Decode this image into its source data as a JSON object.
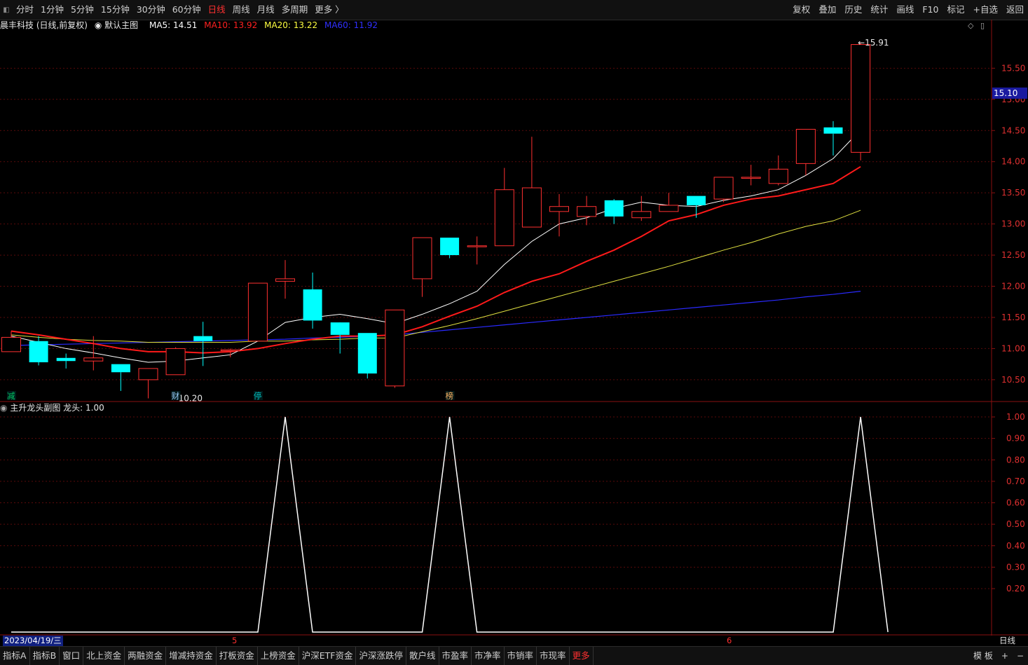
{
  "toolbar": {
    "periods": [
      "分时",
      "1分钟",
      "5分钟",
      "15分钟",
      "30分钟",
      "60分钟",
      "日线",
      "周线",
      "月线",
      "多周期",
      "更多 〉"
    ],
    "active_period": "日线",
    "right_buttons": [
      "复权",
      "叠加",
      "历史",
      "统计",
      "画线",
      "F10",
      "标记",
      "+自选",
      "返回"
    ]
  },
  "info": {
    "stock": "晨丰科技 (日线,前复权)",
    "template": "默认主图",
    "ma5": "MA5: 14.51",
    "ma10": "MA10: 13.92",
    "ma20": "MA20: 13.22",
    "ma60": "MA60: 11.92",
    "colors": {
      "ma5": "#ffffff",
      "ma10": "#ff2020",
      "ma20": "#ffff40",
      "ma60": "#2222ff"
    }
  },
  "sub_panel": {
    "title": "主升龙头副图",
    "value": "龙头: 1.00"
  },
  "markers": [
    {
      "idx": 0,
      "text": "减",
      "color": "#00c060"
    },
    {
      "idx": 6,
      "text": "财",
      "color": "#a0d0ff"
    },
    {
      "idx": 9,
      "text": "停",
      "color": "#00c0c0"
    },
    {
      "idx": 16,
      "text": "榜",
      "color": "#ffb060"
    }
  ],
  "annotations": {
    "low": "10.20",
    "high": "15.91"
  },
  "last_price": "15.10",
  "date_axis": {
    "start": "2023/04/19/三",
    "month_5": "5",
    "month_6": "6",
    "period": "日线"
  },
  "chart_data": {
    "type": "candlestick",
    "price_ticks": [
      "15.50",
      "15.00",
      "14.50",
      "14.00",
      "13.50",
      "13.00",
      "12.50",
      "12.00",
      "11.50",
      "11.00",
      "10.50"
    ],
    "price_range": [
      10.15,
      16.1
    ],
    "ohlc": [
      [
        10.95,
        11.18,
        11.28,
        10.95
      ],
      [
        11.12,
        10.78,
        11.2,
        10.73
      ],
      [
        10.85,
        10.8,
        10.92,
        10.68
      ],
      [
        10.8,
        10.85,
        11.2,
        10.65
      ],
      [
        10.75,
        10.62,
        10.75,
        10.32
      ],
      [
        10.5,
        10.68,
        10.68,
        10.2
      ],
      [
        10.58,
        11.0,
        11.02,
        10.58
      ],
      [
        11.2,
        11.12,
        11.43,
        10.72
      ],
      [
        10.98,
        10.98,
        11.0,
        10.86
      ],
      [
        11.12,
        12.05,
        12.05,
        11.12
      ],
      [
        12.08,
        12.12,
        12.42,
        11.8
      ],
      [
        11.95,
        11.45,
        12.22,
        11.32
      ],
      [
        11.42,
        11.22,
        11.4,
        10.92
      ],
      [
        11.25,
        10.6,
        11.25,
        10.52
      ],
      [
        10.4,
        11.62,
        11.62,
        10.37
      ],
      [
        12.12,
        12.78,
        12.78,
        11.83
      ],
      [
        12.78,
        12.5,
        12.78,
        12.45
      ],
      [
        12.65,
        12.65,
        12.8,
        12.35
      ],
      [
        12.65,
        13.55,
        13.9,
        12.65
      ],
      [
        12.95,
        13.58,
        14.4,
        12.95
      ],
      [
        13.2,
        13.28,
        13.48,
        12.8
      ],
      [
        13.12,
        13.28,
        13.45,
        12.98
      ],
      [
        13.38,
        13.12,
        13.4,
        13.0
      ],
      [
        13.1,
        13.2,
        13.45,
        13.05
      ],
      [
        13.2,
        13.3,
        13.5,
        13.2
      ],
      [
        13.45,
        13.3,
        13.45,
        13.1
      ],
      [
        13.4,
        13.75,
        13.75,
        13.35
      ],
      [
        13.75,
        13.75,
        13.95,
        13.62
      ],
      [
        13.65,
        13.88,
        14.1,
        13.62
      ],
      [
        13.97,
        14.52,
        14.52,
        13.78
      ],
      [
        14.55,
        14.45,
        14.65,
        14.1
      ],
      [
        14.15,
        15.88,
        15.91,
        14.02
      ]
    ],
    "ma5": [
      11.2,
      11.1,
      11.0,
      10.93,
      10.85,
      10.78,
      10.8,
      10.85,
      10.9,
      11.12,
      11.42,
      11.5,
      11.55,
      11.48,
      11.4,
      11.55,
      11.72,
      11.92,
      12.35,
      12.72,
      13.0,
      13.1,
      13.25,
      13.35,
      13.3,
      13.28,
      13.38,
      13.45,
      13.55,
      13.78,
      14.05,
      14.51
    ],
    "ma10": [
      11.28,
      11.22,
      11.15,
      11.08,
      11.0,
      10.95,
      10.95,
      10.93,
      10.95,
      11.0,
      11.08,
      11.15,
      11.2,
      11.2,
      11.22,
      11.35,
      11.52,
      11.68,
      11.9,
      12.08,
      12.2,
      12.4,
      12.58,
      12.8,
      13.05,
      13.15,
      13.3,
      13.4,
      13.45,
      13.55,
      13.65,
      13.92
    ],
    "ma20": [
      11.22,
      11.18,
      11.15,
      11.13,
      11.12,
      11.1,
      11.1,
      11.1,
      11.1,
      11.12,
      11.12,
      11.14,
      11.15,
      11.17,
      11.17,
      11.27,
      11.37,
      11.48,
      11.6,
      11.72,
      11.84,
      11.96,
      12.08,
      12.2,
      12.32,
      12.45,
      12.58,
      12.7,
      12.84,
      12.96,
      13.05,
      13.22
    ],
    "ma60": [
      11.05,
      11.06,
      11.07,
      11.08,
      11.09,
      11.1,
      11.11,
      11.12,
      11.13,
      11.14,
      11.15,
      11.17,
      11.18,
      11.2,
      11.22,
      11.26,
      11.3,
      11.34,
      11.38,
      11.42,
      11.46,
      11.5,
      11.54,
      11.58,
      11.62,
      11.66,
      11.7,
      11.74,
      11.78,
      11.83,
      11.87,
      11.92
    ],
    "sub_ticks": [
      "1.00",
      "0.90",
      "0.80",
      "0.70",
      "0.60",
      "0.50",
      "0.40",
      "0.30",
      "0.20"
    ],
    "signal": [
      0,
      0,
      0,
      0,
      0,
      0,
      0,
      0,
      0,
      0,
      1,
      0,
      0,
      0,
      0,
      0,
      1,
      0,
      0,
      0,
      0,
      0,
      0,
      0,
      0,
      0,
      0,
      0,
      0,
      0,
      0,
      1
    ]
  }
}
